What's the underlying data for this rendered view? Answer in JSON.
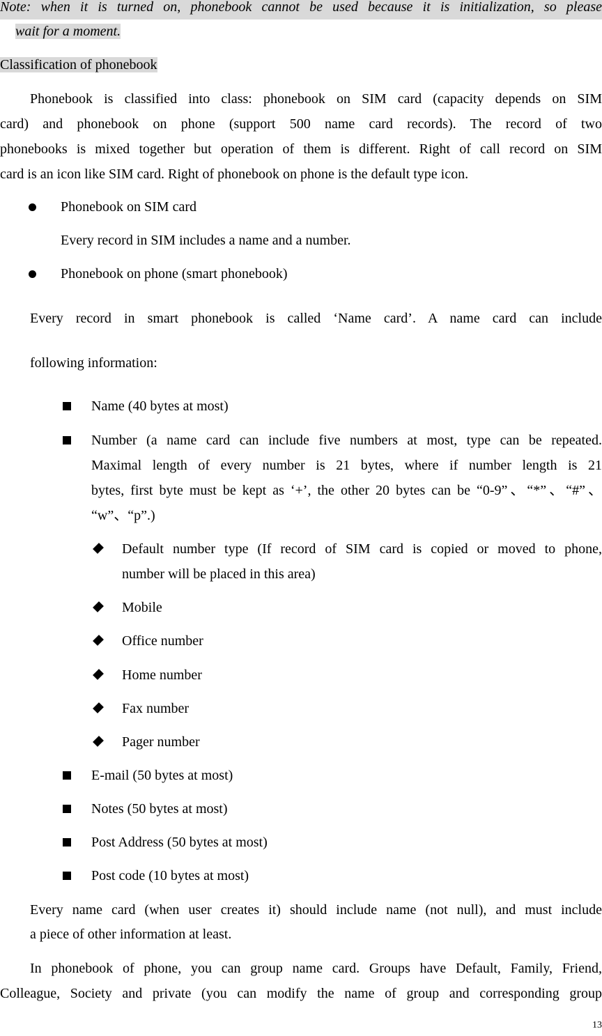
{
  "note": {
    "line1": "Note: when it is turned on, phonebook cannot be used because it is initialization, so please",
    "line2": "wait for a moment."
  },
  "section_heading": "Classification of phonebook",
  "intro_paragraph": {
    "lines": [
      "Phonebook is classified into class: phonebook on SIM card (capacity depends on SIM",
      "card) and phonebook on phone (support 500 name card records). The record of two",
      "phonebooks is mixed together but operation of them is different. Right of call record on SIM",
      "card is an icon like SIM card. Right of phonebook on phone is the default type icon."
    ]
  },
  "phonebook_types": [
    {
      "label": "Phonebook on SIM card",
      "description": "Every record in SIM includes a name and a number."
    },
    {
      "label": "Phonebook on phone (smart phonebook)"
    }
  ],
  "smart_phonebook_paragraph": {
    "line1": "Every record in smart phonebook is called ‘Name card’. A name card can include",
    "line2": "following information:"
  },
  "name_card_fields": [
    {
      "label": "Name (40 bytes at most)"
    },
    {
      "lines": [
        "Number (a name card can include five numbers at most, type can be repeated.",
        "Maximal length of every number is 21 bytes, where if number length is 21",
        "bytes, first byte must be kept as ‘+’, the other 20 bytes can be “0-9”、“*”、“#”、",
        "“w”、“p”.)"
      ]
    },
    {
      "label": "E-mail (50 bytes at most)"
    },
    {
      "label": "Notes (50 bytes at most)"
    },
    {
      "label": "Post Address (50 bytes at most)"
    },
    {
      "label": "Post code (10 bytes at most)"
    }
  ],
  "number_types": [
    {
      "lines": [
        "Default number type (If record of SIM card is copied or moved to phone,",
        "number will be placed in this area)"
      ]
    },
    {
      "lines": [
        "Mobile"
      ]
    },
    {
      "lines": [
        "Office number"
      ]
    },
    {
      "lines": [
        "Home number"
      ]
    },
    {
      "lines": [
        "Fax number"
      ]
    },
    {
      "lines": [
        "Pager number"
      ]
    }
  ],
  "closing_paragraph_1": {
    "line1": "Every name card (when user creates it) should include name (not null), and must include",
    "line2": "a piece of other information at least."
  },
  "closing_paragraph_2": {
    "line1": "In phonebook of phone, you can group name card. Groups have Default, Family, Friend,",
    "line2": "Colleague, Society and private (you can modify the name of group and corresponding group"
  },
  "page_number": "13",
  "colors": {
    "highlight": "#d9d9d9",
    "text": "#000000"
  }
}
